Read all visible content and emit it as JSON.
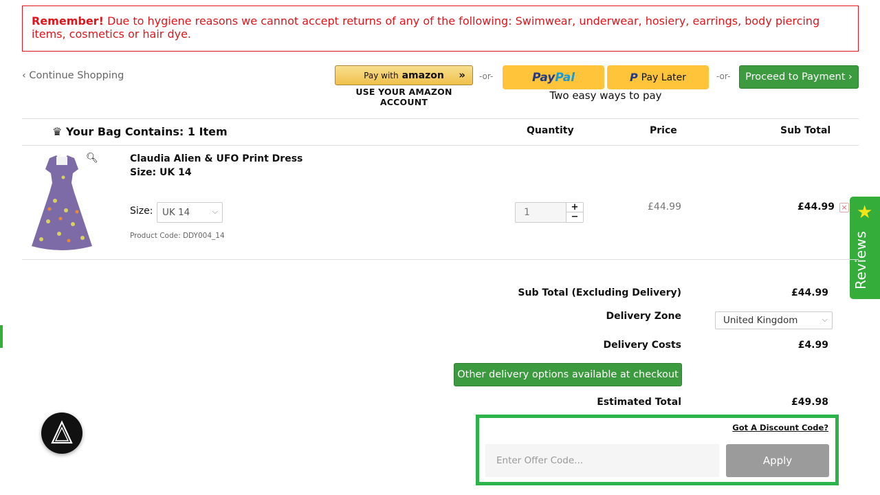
{
  "notice": {
    "bold": "Remember!",
    "text": " Due to hygiene reasons we cannot accept returns of any of the following: Swimwear, underwear, hosiery, earrings, body piercing items, cosmetics or hair dye."
  },
  "nav": {
    "continue": "‹ Continue Shopping"
  },
  "amazon": {
    "pay_with": "Pay with",
    "brand": "amazon",
    "sub": "USE YOUR AMAZON ACCOUNT"
  },
  "or_text": "-or-",
  "paypal": {
    "brand_a": "Pay",
    "brand_b": "Pal",
    "later_icon": "P",
    "later": "Pay Later",
    "caption": "Two easy ways to pay"
  },
  "proceed": "Proceed to Payment ›",
  "bag": {
    "title": "Your Bag Contains: 1 Item",
    "headers": {
      "quantity": "Quantity",
      "price": "Price",
      "subtotal": "Sub Total"
    }
  },
  "item": {
    "name": "Claudia Alien & UFO Print Dress",
    "size_line": "Size: UK 14",
    "size_label": "Size:",
    "size_value": "UK 14",
    "code": "Product Code: DDY004_14",
    "quantity": "1",
    "price": "£44.99",
    "total": "£44.99"
  },
  "summary": {
    "subtotal_label": "Sub Total (Excluding Delivery)",
    "subtotal_value": "£44.99",
    "zone_label": "Delivery Zone",
    "zone_value": "United Kingdom",
    "costs_label": "Delivery Costs",
    "costs_value": "£4.99",
    "other_delivery": "Other delivery options available at checkout",
    "total_label": "Estimated Total",
    "total_value": "£49.98"
  },
  "discount": {
    "link": "Got A Discount Code?",
    "placeholder": "Enter Offer Code...",
    "apply": "Apply"
  },
  "reviews": {
    "label": "Reviews"
  },
  "colors": {
    "accent_green": "#3d9b3f",
    "warning_red": "#e0151b",
    "paypal_yellow": "#ffc439",
    "highlight_green": "#2cb34a"
  }
}
